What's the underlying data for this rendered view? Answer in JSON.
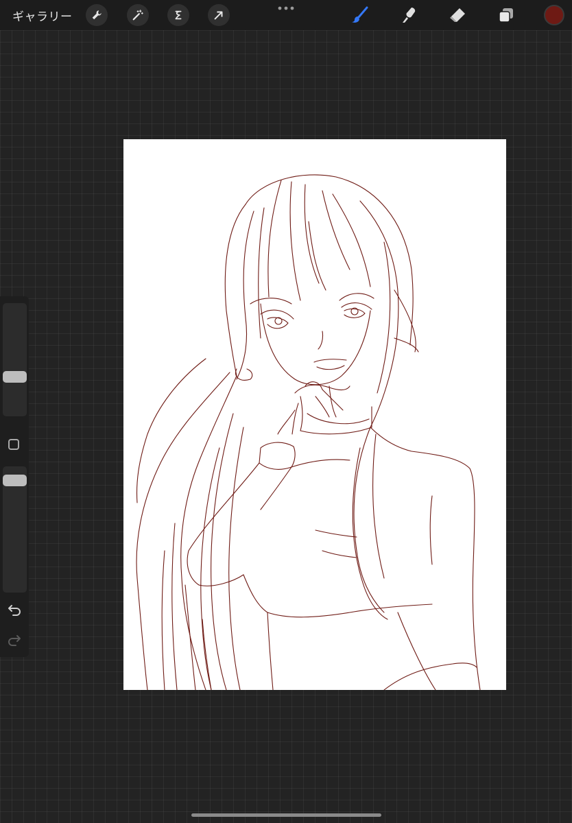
{
  "topbar": {
    "gallery_label": "ギャラリー",
    "left_tools": [
      {
        "icon": "wrench-icon",
        "name": "actions"
      },
      {
        "icon": "magic-wand-icon",
        "name": "adjustments"
      },
      {
        "icon": "selection-s-icon",
        "name": "selection"
      },
      {
        "icon": "arrow-cursor-icon",
        "name": "transform"
      }
    ],
    "more_icon": "more-dots-icon",
    "right_tools": [
      {
        "icon": "brush-icon",
        "name": "paint",
        "active": true
      },
      {
        "icon": "smudge-icon",
        "name": "smudge",
        "active": false
      },
      {
        "icon": "eraser-icon",
        "name": "erase",
        "active": false
      },
      {
        "icon": "layers-icon",
        "name": "layers",
        "active": false
      }
    ],
    "current_color": "#6e1a14",
    "active_tool_color": "#3478f6"
  },
  "sidebar": {
    "brush_size_level": 0.33,
    "opacity_level": 0.93,
    "modify_icon": "square-modify-icon",
    "undo_icon": "undo-arrow-icon",
    "redo_icon": "redo-arrow-icon"
  },
  "canvas": {
    "background": "#ffffff",
    "line_color": "#6e1a14",
    "content": "line-art-illustration"
  },
  "colors": {
    "app_background": "#232323",
    "toolbar_background": "#1c1c1c"
  }
}
